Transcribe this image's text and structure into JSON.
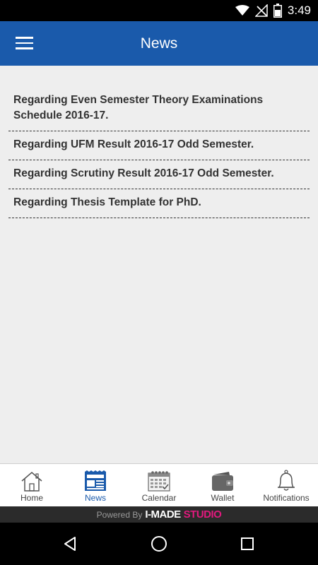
{
  "status_bar": {
    "time": "3:49"
  },
  "app_bar": {
    "title": "News"
  },
  "news": {
    "items": [
      "Regarding Even Semester Theory Examinations Schedule 2016-17.",
      "Regarding UFM Result 2016-17 Odd Semester.",
      "Regarding Scrutiny Result 2016-17 Odd Semester.",
      "Regarding Thesis Template for PhD."
    ]
  },
  "bottom_nav": {
    "items": [
      {
        "label": "Home",
        "icon": "home-icon"
      },
      {
        "label": "News",
        "icon": "newspaper-icon",
        "active": true
      },
      {
        "label": "Calendar",
        "icon": "calendar-icon"
      },
      {
        "label": "Wallet",
        "icon": "wallet-icon"
      },
      {
        "label": "Notifications",
        "icon": "bell-icon"
      }
    ]
  },
  "footer": {
    "powered_by": "Powered By",
    "brand_main": "I-MADE",
    "brand_accent": "STUDIO"
  },
  "colors": {
    "primary": "#1a5aab",
    "brand_accent": "#e0197d"
  }
}
